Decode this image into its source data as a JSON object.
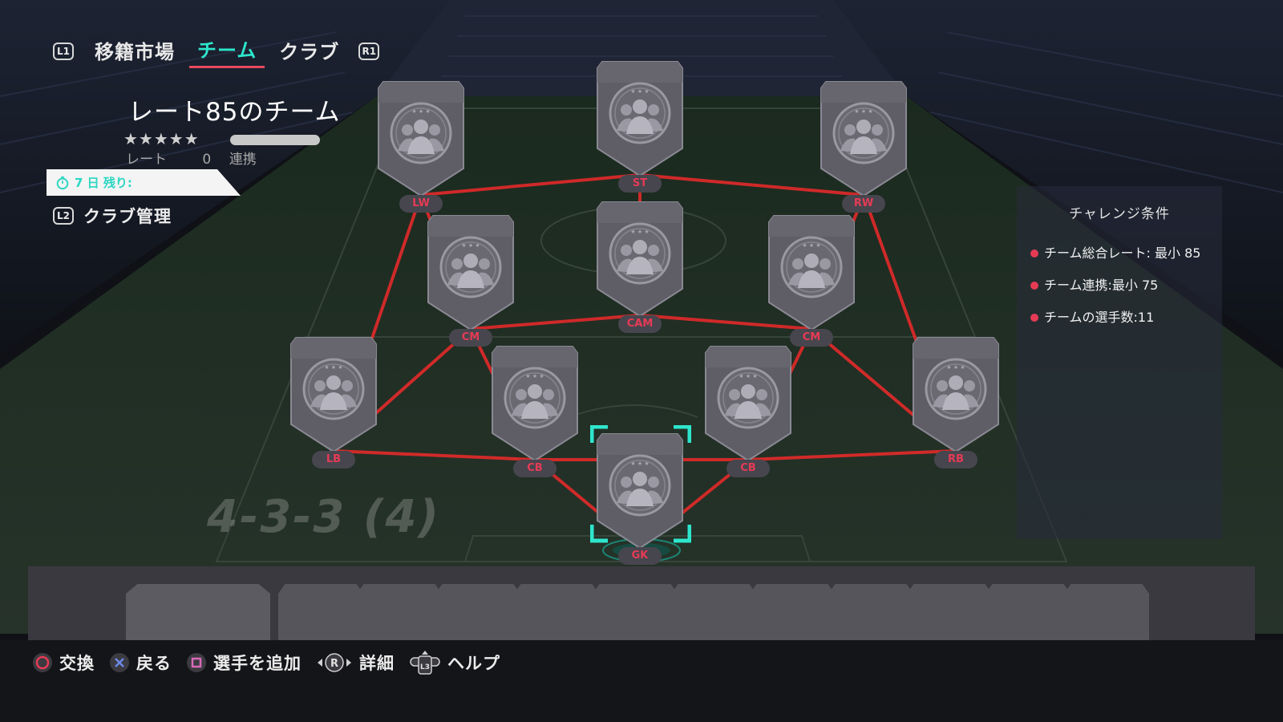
{
  "nav": {
    "left_button": "L1",
    "tabs": [
      {
        "label": "移籍市場",
        "active": false
      },
      {
        "label": "チーム",
        "active": true
      },
      {
        "label": "クラブ",
        "active": false
      }
    ],
    "right_button": "R1"
  },
  "squad": {
    "title": "レート85のチーム",
    "stars": "★★★★★",
    "rating_label": "レート",
    "rating_value": "0",
    "chemistry_label": "連携"
  },
  "timer": {
    "text": "7 日 残り:"
  },
  "club_management": {
    "button": "L2",
    "label": "クラブ管理"
  },
  "formation": {
    "name": "4-3-3 (4)"
  },
  "positions": [
    {
      "id": "lw",
      "label": "LW"
    },
    {
      "id": "st",
      "label": "ST"
    },
    {
      "id": "rw",
      "label": "RW"
    },
    {
      "id": "cm-left",
      "label": "CM"
    },
    {
      "id": "cam",
      "label": "CAM"
    },
    {
      "id": "cm-right",
      "label": "CM"
    },
    {
      "id": "lb",
      "label": "LB"
    },
    {
      "id": "cb-left",
      "label": "CB"
    },
    {
      "id": "gk",
      "label": "GK"
    },
    {
      "id": "cb-right",
      "label": "CB"
    },
    {
      "id": "rb",
      "label": "RB"
    }
  ],
  "selected_position": "GK",
  "challenge": {
    "title": "チャレンジ条件",
    "requirements": [
      "チーム総合レート: 最小 85",
      "チーム連携:最小 75",
      "チームの選手数:11"
    ]
  },
  "footer": {
    "hints": [
      {
        "button": "circle",
        "label": "交換"
      },
      {
        "button": "cross",
        "label": "戻る"
      },
      {
        "button": "square",
        "label": "選手を追加"
      },
      {
        "button": "R",
        "label": "詳細"
      },
      {
        "button": "L3",
        "label": "ヘルプ"
      }
    ]
  },
  "colors": {
    "accent_teal": "#2ee6cc",
    "position_red": "#e63a55",
    "link_line": "#e32a2a",
    "card_gray": "#5f5d66"
  },
  "icons": [
    "timer-icon",
    "silhouette-icon",
    "circle-button-icon",
    "cross-button-icon",
    "square-button-icon",
    "r-stick-icon",
    "l3-icon"
  ]
}
